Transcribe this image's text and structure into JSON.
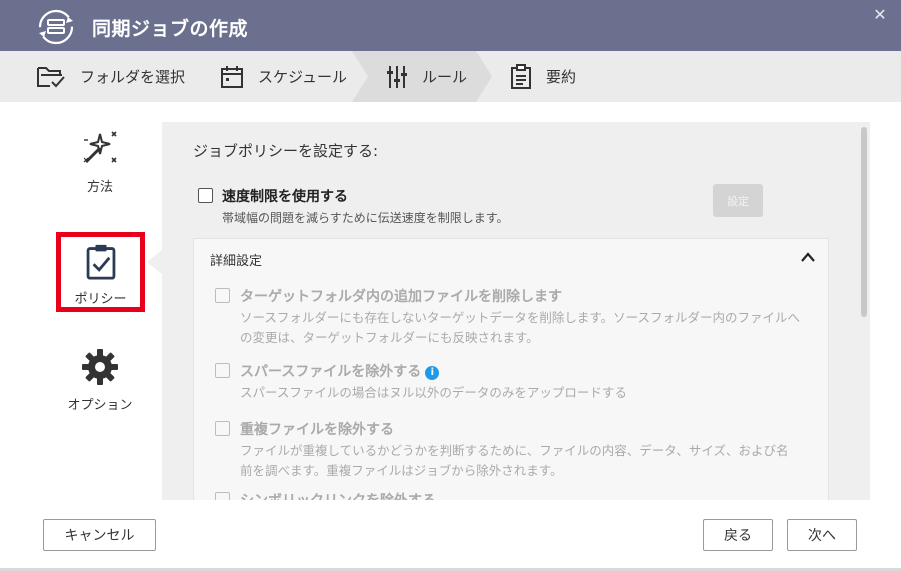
{
  "window": {
    "title": "同期ジョブの作成",
    "close_glyph": "✕"
  },
  "steps": [
    {
      "label": "フォルダを選択",
      "icon": "folder-check-icon"
    },
    {
      "label": "スケジュール",
      "icon": "calendar-icon"
    },
    {
      "label": "ルール",
      "icon": "sliders-icon",
      "active": true
    },
    {
      "label": "要約",
      "icon": "clipboard-list-icon"
    }
  ],
  "sidebar": {
    "items": [
      {
        "label": "方法",
        "icon": "magic-wand-icon"
      },
      {
        "label": "ポリシー",
        "icon": "clipboard-check-icon",
        "selected": true
      },
      {
        "label": "オプション",
        "icon": "gear-icon"
      }
    ]
  },
  "policy": {
    "heading": "ジョブポリシーを設定する:",
    "speed_limit": {
      "label": "速度制限を使用する",
      "description": "帯域幅の問題を減らすために伝送速度を制限します。",
      "checked": false,
      "settings_button": "設定"
    },
    "advanced": {
      "title": "詳細設定",
      "expanded": true,
      "options": [
        {
          "label": "ターゲットフォルダ内の追加ファイルを削除します",
          "description": "ソースフォルダーにも存在しないターゲットデータを削除します。ソースフォルダー内のファイルへの変更は、ターゲットフォルダーにも反映されます。",
          "checked": false
        },
        {
          "label": "スパースファイルを除外する",
          "description": "スパースファイルの場合はヌル以外のデータのみをアップロードする",
          "checked": false,
          "info_glyph": "i"
        },
        {
          "label": "重複ファイルを除外する",
          "description": "ファイルが重複しているかどうかを判断するために、ファイルの内容、データ、サイズ、および名前を調べます。重複ファイルはジョブから除外されます。",
          "checked": false
        },
        {
          "label": "シンボリックリンクを除外する",
          "description": "",
          "checked": false
        }
      ]
    }
  },
  "footer": {
    "cancel": "キャンセル",
    "back": "戻る",
    "next": "次へ"
  },
  "colors": {
    "titlebar": "#6b708f",
    "stepbar": "#ebebeb",
    "selected_border": "#e8001a",
    "accent_blue": "#1e9be8",
    "icon_dark": "#2b3a55"
  }
}
